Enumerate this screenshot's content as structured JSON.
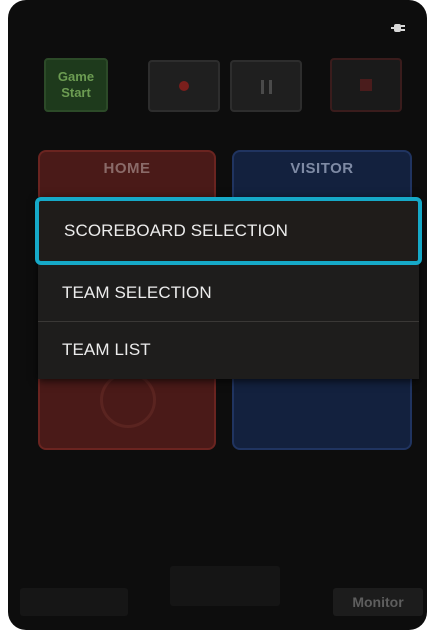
{
  "status_bar": {
    "charging_icon": "plug-icon"
  },
  "controls": {
    "game_start_label": "Game\nStart",
    "record_icon": "record-icon",
    "pause_icon": "pause-icon",
    "stop_icon": "stop-icon"
  },
  "teams": {
    "home_label": "HOME",
    "visitor_label": "VISITOR",
    "home_color": "#4a1a18",
    "visitor_color": "#13213e"
  },
  "menu": {
    "items": [
      {
        "label": "SCOREBOARD SELECTION",
        "selected": true
      },
      {
        "label": "TEAM SELECTION",
        "selected": false
      },
      {
        "label": "TEAM LIST",
        "selected": false
      }
    ],
    "highlight_color": "#16a9c8"
  },
  "bottom_bar": {
    "monitor_label": "Monitor"
  }
}
